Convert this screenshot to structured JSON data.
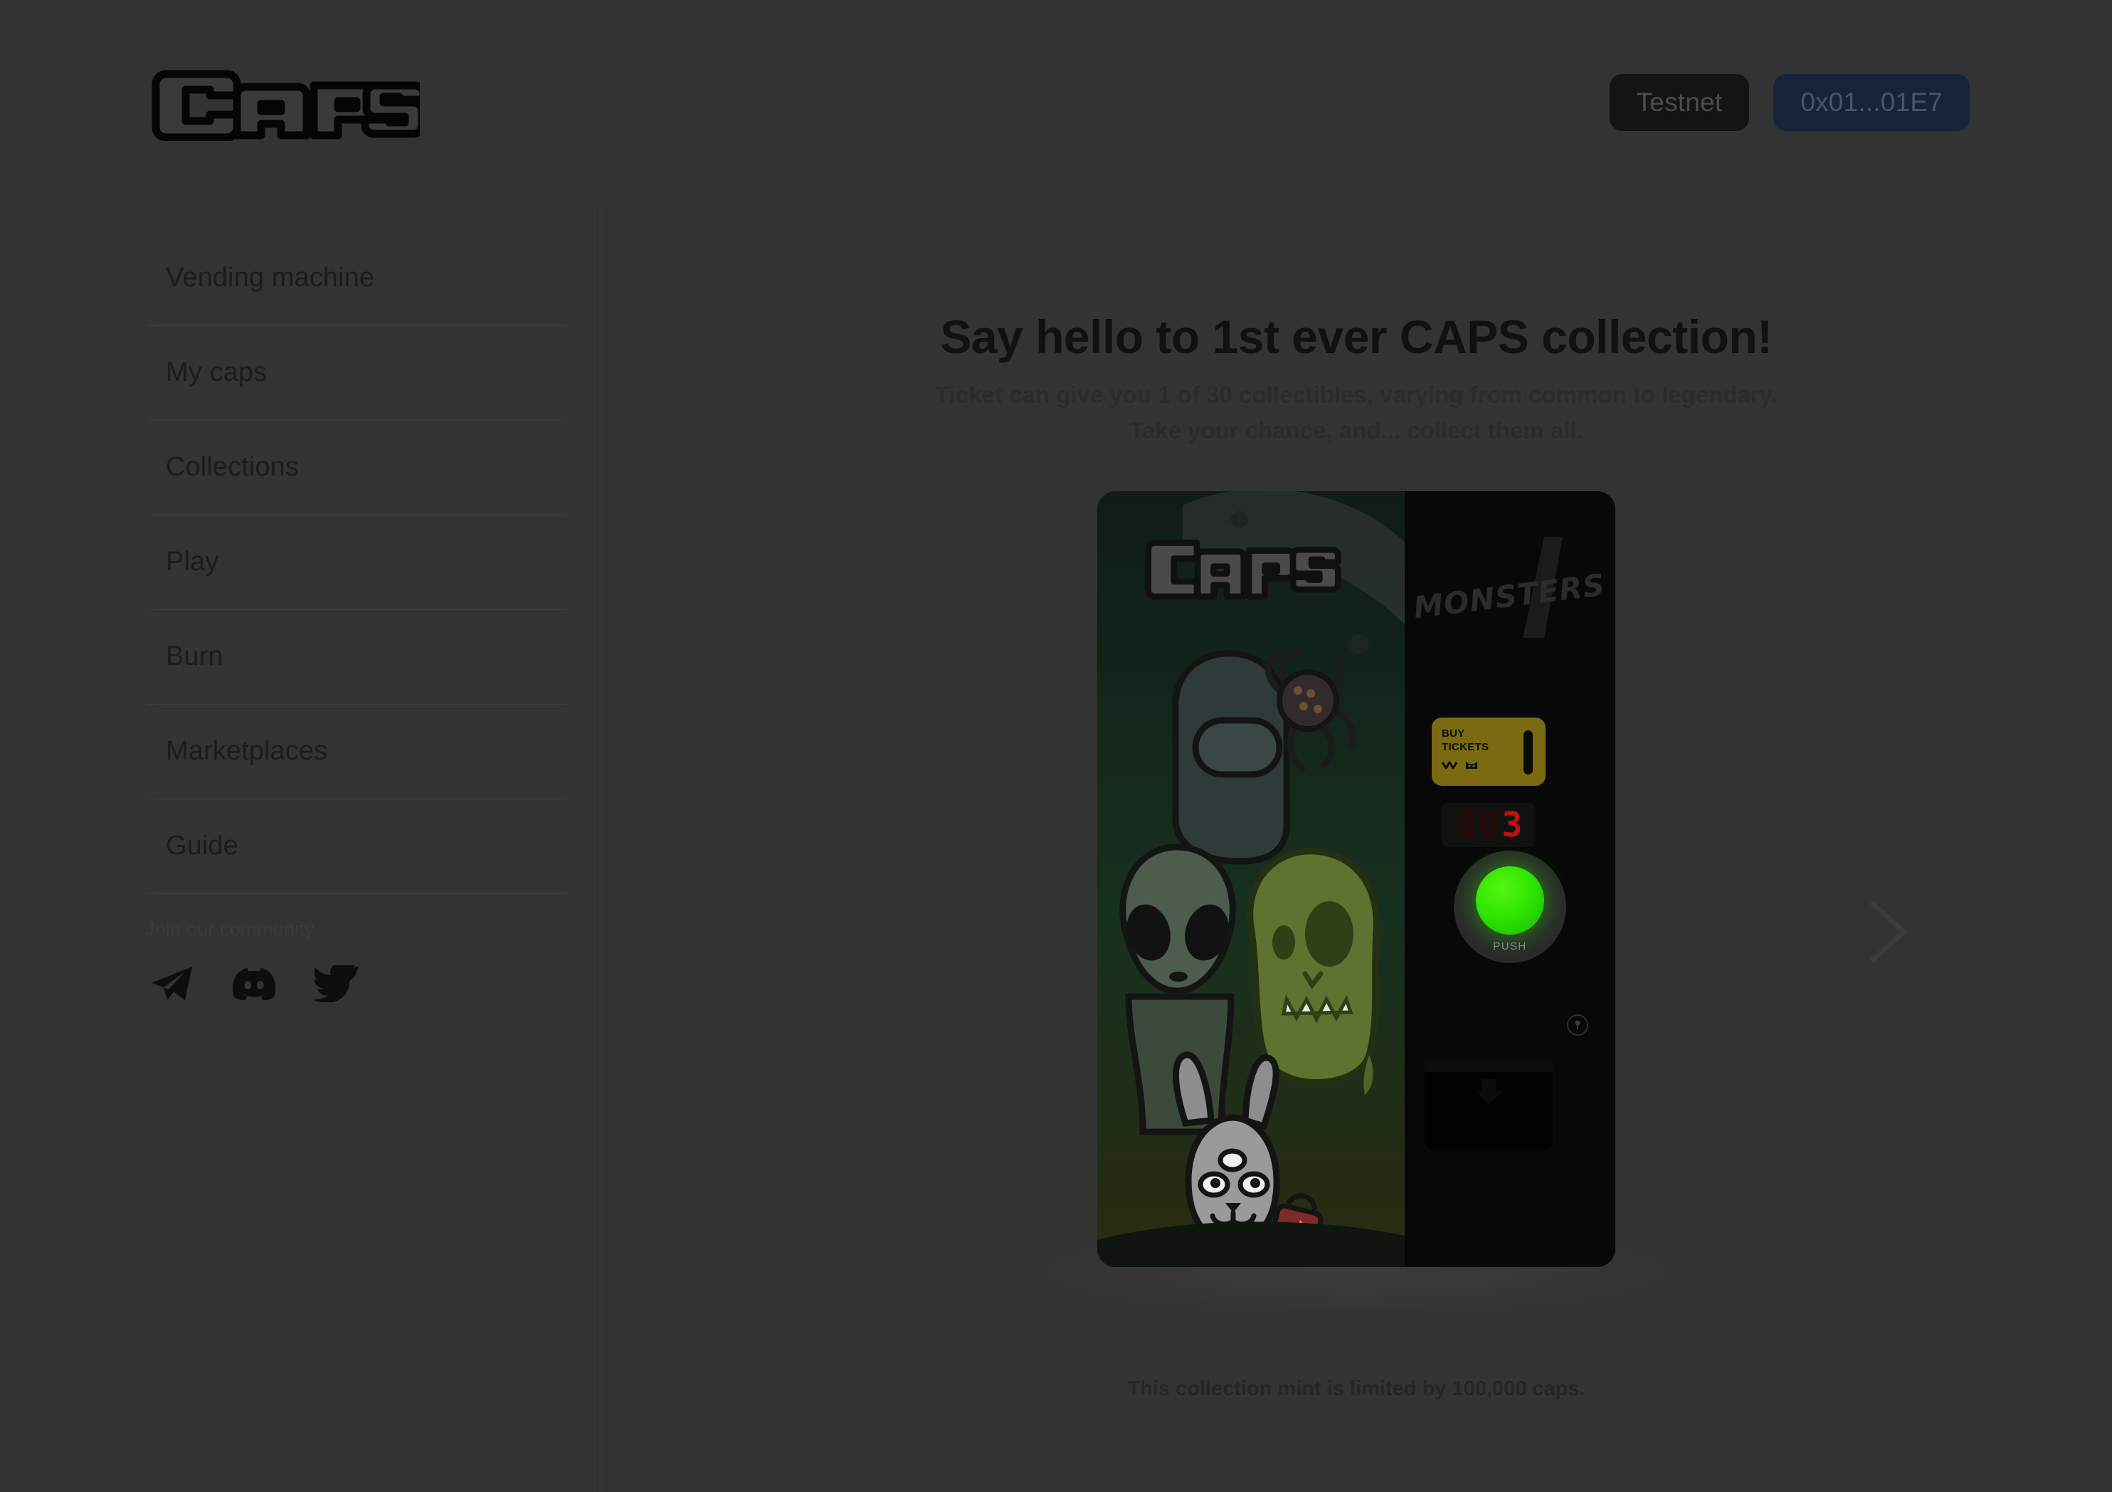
{
  "header": {
    "logo_text": "CAPS",
    "logo_icon": "caps-wordmark-logo",
    "network_label": "Testnet",
    "wallet_address": "0x01...01E7"
  },
  "sidebar": {
    "items": [
      {
        "label": "Vending machine"
      },
      {
        "label": "My caps"
      },
      {
        "label": "Collections"
      },
      {
        "label": "Play"
      },
      {
        "label": "Burn"
      },
      {
        "label": "Marketplaces"
      },
      {
        "label": "Guide"
      }
    ],
    "community": {
      "label": "Join our community",
      "socials": [
        {
          "icon": "telegram-icon",
          "name": "Telegram"
        },
        {
          "icon": "discord-icon",
          "name": "Discord"
        },
        {
          "icon": "twitter-icon",
          "name": "Twitter"
        }
      ]
    }
  },
  "main": {
    "title": "Say hello to 1st ever CAPS collection!",
    "subtitle_line1": "Ticket can give you 1 of 30 collectibles, varying from common to legendary.",
    "subtitle_line2": "Take your chance, and... collect them all.",
    "mint_note": "This collection mint is limited by 100,000 caps.",
    "next_arrow_icon": "chevron-right-icon",
    "machine": {
      "window_logo": "caps-wordmark-logo",
      "panel_brand": "MONSTERS",
      "panel_brand_number": "1",
      "ticket_slot_line1": "BUY",
      "ticket_slot_line2": "TICKETS",
      "counter_digits": [
        "0",
        "0",
        "3"
      ],
      "counter_value": "003",
      "counter_lit_index": 2,
      "push_label": "PUSH",
      "keyhole_icon": "keyhole-icon",
      "dispenser_icon": "arrow-down-icon"
    }
  },
  "colors": {
    "background": "#333333",
    "panel_black": "#080808",
    "wallet_pill": "#17233a",
    "testnet_pill": "#141414",
    "push_green": "#2ee500",
    "led_red": "#c01010",
    "ticket_yellow": "#7a6a12"
  }
}
